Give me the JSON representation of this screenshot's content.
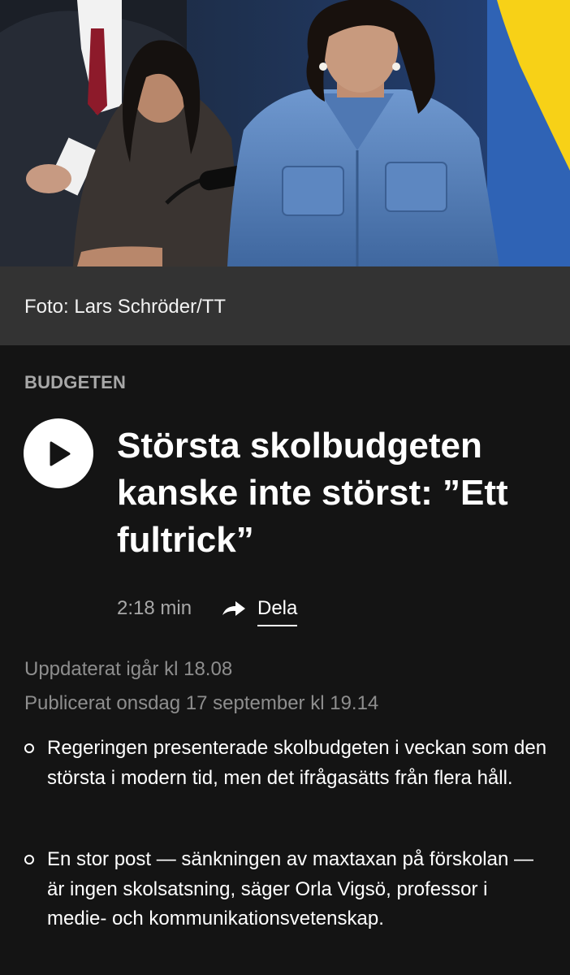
{
  "hero": {
    "image_description_icon": "press-photo",
    "flag_colors": [
      "#2f63b5",
      "#f7d117"
    ]
  },
  "caption": {
    "credit": "Foto: Lars Schröder/TT"
  },
  "article": {
    "category": "BUDGETEN",
    "headline": "Största skolbudgeten kanske inte störst: ”Ett fultrick”",
    "duration": "2:18 min",
    "share_label": "Dela",
    "updated": "Uppdaterat igår kl 18.08",
    "published": "Publicerat onsdag 17 september kl 19.14",
    "summary": [
      "Regeringen presenterade skolbudgeten i veckan som den största i modern tid, men det ifrågasätts från flera håll.",
      "En stor post — sänkningen av maxtaxan på förskolan — är ingen skolsatsning, säger Orla Vigsö, professor i medie- och kommunikationsvetenskap."
    ]
  },
  "colors": {
    "background": "#141414",
    "caption_bar": "#333333",
    "muted_text": "#a8a8a8",
    "meta_text": "#8e8e8e",
    "text": "#ffffff"
  }
}
